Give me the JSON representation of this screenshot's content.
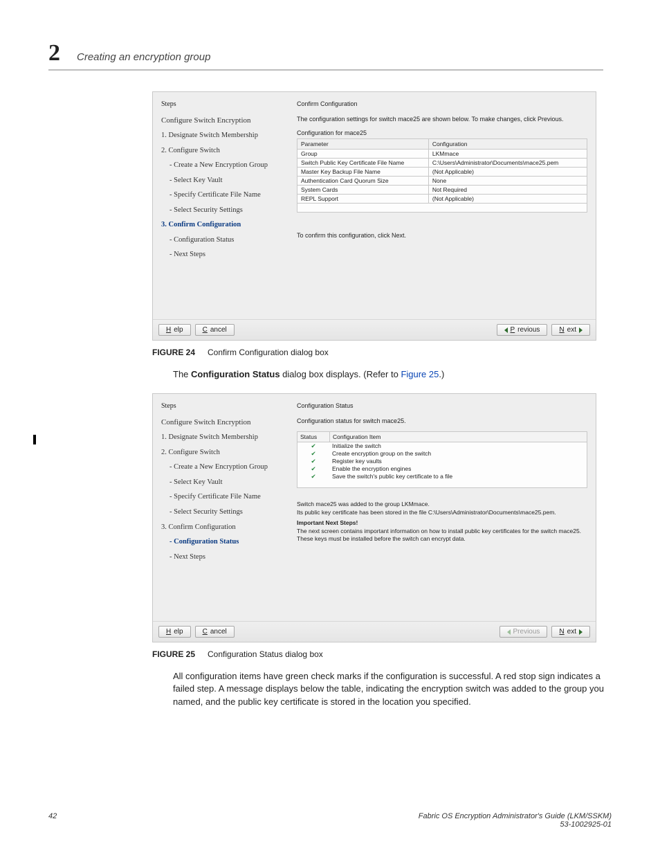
{
  "chapter": {
    "number": "2",
    "title": "Creating an encryption group"
  },
  "figure24": {
    "label": "FIGURE 24",
    "caption": "Confirm Configuration dialog box",
    "stepsTitle": "Steps",
    "stepsHeading": "Configure Switch Encryption",
    "steps": [
      "1. Designate Switch Membership",
      "2. Configure Switch",
      "  - Create a New Encryption Group",
      "  - Select Key Vault",
      "  - Specify Certificate File Name",
      "  - Select Security Settings",
      "3. Confirm Configuration",
      "  - Configuration Status",
      "  - Next Steps"
    ],
    "currentIndex": 6,
    "panelTitle": "Confirm Configuration",
    "desc": "The configuration settings for switch mace25 are shown below. To make changes, click Previous.",
    "subhead": "Configuration for mace25",
    "headers": [
      "Parameter",
      "Configuration"
    ],
    "rows": [
      [
        "Group",
        "LKMmace"
      ],
      [
        "Switch Public Key Certificate File Name",
        "C:\\Users\\Administrator\\Documents\\mace25.pem"
      ],
      [
        "Master Key Backup File Name",
        "(Not Applicable)"
      ],
      [
        "Authentication Card Quorum Size",
        "None"
      ],
      [
        "System Cards",
        "Not Required"
      ],
      [
        "REPL Support",
        "(Not Applicable)"
      ]
    ],
    "confirmNote": "To confirm this configuration, click Next.",
    "buttons": {
      "help": "Help",
      "cancel": "Cancel",
      "prev": "Previous",
      "next": "Next"
    }
  },
  "bodyText1_pre": "The ",
  "bodyText1_bold": "Configuration Status",
  "bodyText1_mid": " dialog box displays. (Refer to ",
  "bodyText1_link": "Figure 25",
  "bodyText1_suf": ".)",
  "figure25": {
    "label": "FIGURE 25",
    "caption": "Configuration Status dialog box",
    "stepsTitle": "Steps",
    "stepsHeading": "Configure Switch Encryption",
    "steps": [
      "1. Designate Switch Membership",
      "2. Configure Switch",
      "  - Create a New Encryption Group",
      "  - Select Key Vault",
      "  - Specify Certificate File Name",
      "  - Select Security Settings",
      "3. Confirm Configuration",
      "  - Configuration Status",
      "  - Next Steps"
    ],
    "currentIndex": 7,
    "panelTitle": "Configuration Status",
    "desc": "Configuration status for switch mace25.",
    "headers": [
      "Status",
      "Configuration Item"
    ],
    "items": [
      "Initialize the switch",
      "Create encryption group on the switch",
      "Register key vaults",
      "Enable the encryption engines",
      "Save the switch's public key certificate to a file"
    ],
    "msg1": "Switch mace25 was added to the group LKMmace.",
    "msg2": "Its public key certificate has been stored in the file C:\\Users\\Administrator\\Documents\\mace25.pem.",
    "msgBold": "Important Next Steps!",
    "msg3": "The next screen contains important information on how to install public key certificates for the switch mace25. These keys must be installed before the switch can encrypt data.",
    "buttons": {
      "help": "Help",
      "cancel": "Cancel",
      "prev": "Previous",
      "next": "Next"
    }
  },
  "bodyText2": "All configuration items have green check marks if the configuration is successful. A red stop sign indicates a failed step. A message displays below the table, indicating the encryption switch was added to the group you named, and the public key certificate is stored in the location you specified.",
  "footer": {
    "page": "42",
    "title": "Fabric OS Encryption Administrator's Guide  (LKM/SSKM)",
    "docnum": "53-1002925-01"
  }
}
